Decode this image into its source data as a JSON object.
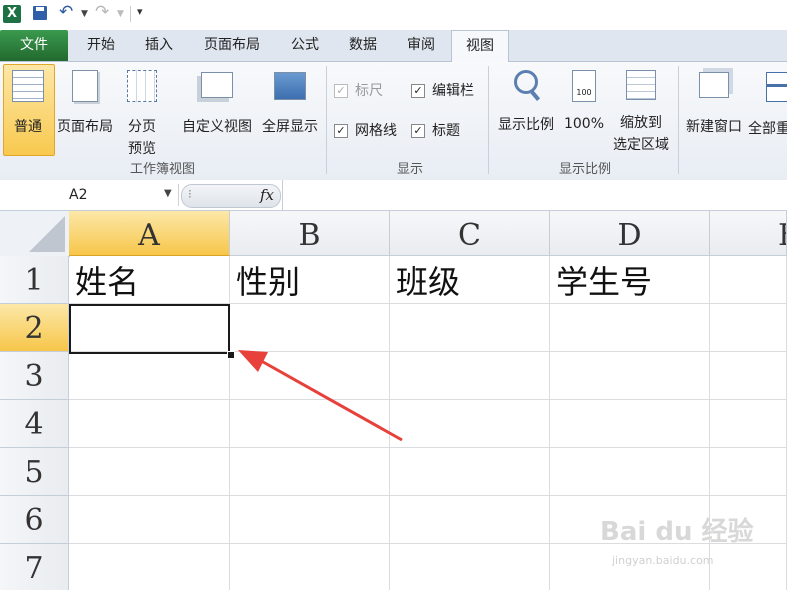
{
  "quick_access": {
    "icons": [
      "excel-logo-icon",
      "save-icon",
      "undo-icon",
      "redo-icon",
      "customize-icon"
    ]
  },
  "tabs": [
    {
      "label": "文件"
    },
    {
      "label": "开始"
    },
    {
      "label": "插入"
    },
    {
      "label": "页面布局"
    },
    {
      "label": "公式"
    },
    {
      "label": "数据"
    },
    {
      "label": "审阅"
    },
    {
      "label": "视图"
    }
  ],
  "ribbon": {
    "workbook_views": {
      "group_label": "工作簿视图",
      "normal": "普通",
      "page_layout": "页面布局",
      "page_break_1": "分页",
      "page_break_2": "预览",
      "custom_views": "自定义视图",
      "full_screen": "全屏显示"
    },
    "show": {
      "group_label": "显示",
      "ruler": "标尺",
      "formula_bar": "编辑栏",
      "gridlines": "网格线",
      "headings": "标题"
    },
    "zoom": {
      "group_label": "显示比例",
      "zoom": "显示比例",
      "zoom_100": "100%",
      "zoom_100_icon_text": "100",
      "zoom_selection_1": "缩放到",
      "zoom_selection_2": "选定区域"
    },
    "window": {
      "new_window": "新建窗口",
      "arrange_all": "全部重"
    }
  },
  "formula_bar": {
    "name_box": "A2",
    "fx": "fx",
    "content": ""
  },
  "sheet": {
    "columns": [
      "A",
      "B",
      "C",
      "D",
      "E"
    ],
    "rows": [
      "1",
      "2",
      "3",
      "4",
      "5",
      "6",
      "7"
    ],
    "row1": [
      "姓名",
      "性别",
      "班级",
      "学生号"
    ],
    "active_cell": "A2"
  },
  "watermark": {
    "text": "Bai du 经验",
    "url": "jingyan.baidu.com"
  },
  "colors": {
    "file_tab": "#2d7a3f",
    "selected_header": "#f7c64a",
    "arrow": "#e8403a"
  }
}
